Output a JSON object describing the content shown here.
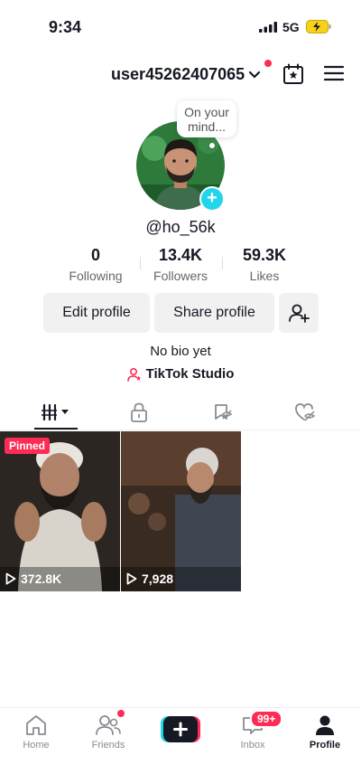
{
  "status_bar": {
    "time": "9:34",
    "network": "5G"
  },
  "header": {
    "username": "user45262407065"
  },
  "bubble": {
    "text": "On your mind..."
  },
  "profile": {
    "handle": "@ho_56k"
  },
  "stats": [
    {
      "value": "0",
      "label": "Following"
    },
    {
      "value": "13.4K",
      "label": "Followers"
    },
    {
      "value": "59.3K",
      "label": "Likes"
    }
  ],
  "buttons": {
    "edit": "Edit profile",
    "share": "Share profile"
  },
  "bio": "No bio yet",
  "studio": "TikTok Studio",
  "videos": [
    {
      "pinned": "Pinned",
      "views": "372.8K"
    },
    {
      "views": "7,928"
    }
  ],
  "nav": {
    "home": "Home",
    "friends": "Friends",
    "inbox": "Inbox",
    "inbox_badge": "99+",
    "profile": "Profile"
  },
  "colors": {
    "accent": "#fe2c55",
    "cyan": "#20d5ec",
    "text": "#161823"
  }
}
